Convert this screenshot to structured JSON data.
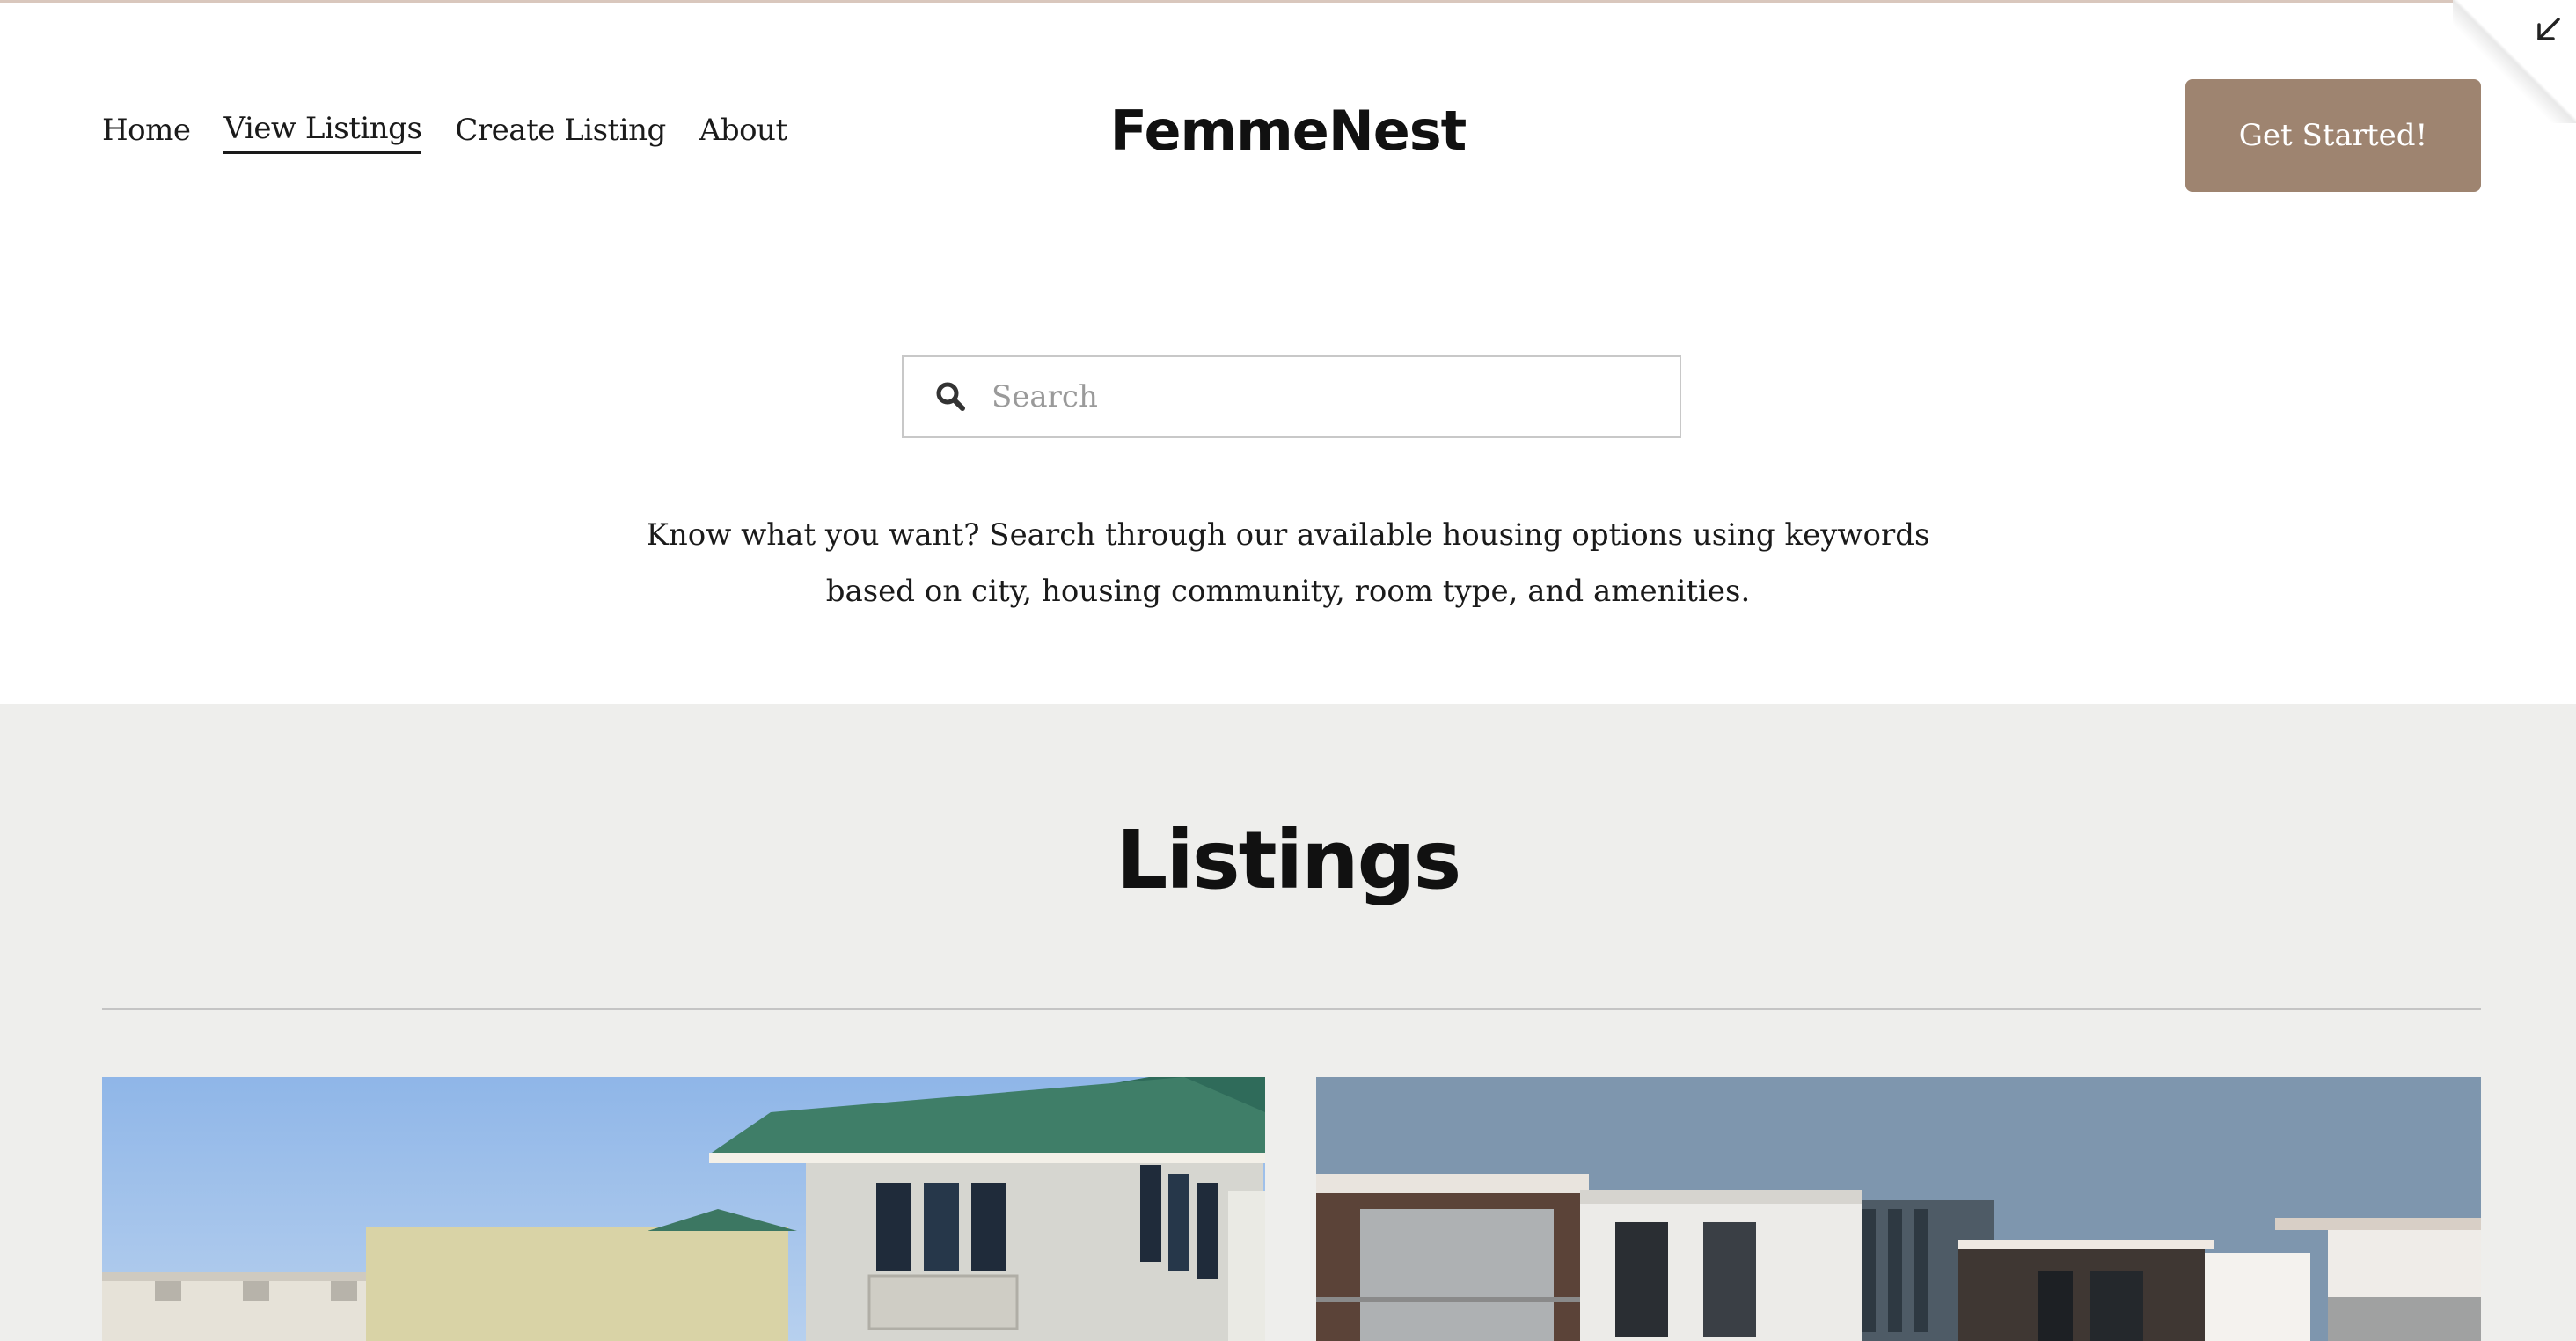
{
  "nav": {
    "items": [
      {
        "label": "Home",
        "active": false
      },
      {
        "label": "View Listings",
        "active": true
      },
      {
        "label": "Create Listing",
        "active": false
      },
      {
        "label": "About",
        "active": false
      }
    ]
  },
  "brand": {
    "name": "FemmeNest"
  },
  "header": {
    "cta_label": "Get Started!"
  },
  "search": {
    "placeholder": "Search",
    "value": ""
  },
  "intro": {
    "line1": "Know what you want? Search through our available housing options using keywords",
    "line2": "based on city, housing community, room type, and amenities."
  },
  "listings": {
    "title": "Listings"
  },
  "colors": {
    "accent": "#9e8470",
    "section_bg": "#eeeeec",
    "text": "#1a1a1a"
  },
  "icons": {
    "search": "search-icon",
    "collapse": "arrow-down-left-icon"
  }
}
